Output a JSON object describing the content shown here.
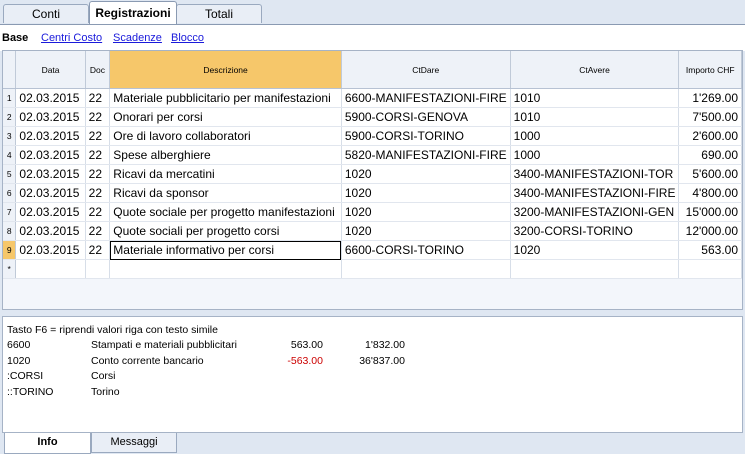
{
  "top_tabs": [
    "Conti",
    "Registrazioni",
    "Totali"
  ],
  "active_top_tab": "Registrazioni",
  "sub_views": {
    "active": "Base",
    "links": [
      "Centri Costo",
      "Scadenze",
      "Blocco"
    ]
  },
  "grid": {
    "columns": [
      "Data",
      "Doc",
      "Descrizione",
      "CtDare",
      "CtAvere",
      "Importo CHF"
    ],
    "rows": [
      {
        "n": "1",
        "data": "02.03.2015",
        "doc": "22",
        "desc": "Materiale pubblicitario per manifestazioni",
        "dare": "6600-MANIFESTAZIONI-FIRE",
        "avere": "1010",
        "importo": "1'269.00"
      },
      {
        "n": "2",
        "data": "02.03.2015",
        "doc": "22",
        "desc": "Onorari per corsi",
        "dare": "5900-CORSI-GENOVA",
        "avere": "1010",
        "importo": "7'500.00"
      },
      {
        "n": "3",
        "data": "02.03.2015",
        "doc": "22",
        "desc": "Ore di lavoro collaboratori",
        "dare": "5900-CORSI-TORINO",
        "avere": "1000",
        "importo": "2'600.00"
      },
      {
        "n": "4",
        "data": "02.03.2015",
        "doc": "22",
        "desc": "Spese alberghiere",
        "dare": "5820-MANIFESTAZIONI-FIRE",
        "avere": "1000",
        "importo": "690.00"
      },
      {
        "n": "5",
        "data": "02.03.2015",
        "doc": "22",
        "desc": "Ricavi da mercatini",
        "dare": "1020",
        "avere": "3400-MANIFESTAZIONI-TOR",
        "importo": "5'600.00"
      },
      {
        "n": "6",
        "data": "02.03.2015",
        "doc": "22",
        "desc": "Ricavi da sponsor",
        "dare": "1020",
        "avere": "3400-MANIFESTAZIONI-FIRE",
        "importo": "4'800.00"
      },
      {
        "n": "7",
        "data": "02.03.2015",
        "doc": "22",
        "desc": "Quote sociale per progetto manifestazioni",
        "dare": "1020",
        "avere": "3200-MANIFESTAZIONI-GEN",
        "importo": "15'000.00"
      },
      {
        "n": "8",
        "data": "02.03.2015",
        "doc": "22",
        "desc": "Quote sociali per progetto corsi",
        "dare": "1020",
        "avere": "3200-CORSI-TORINO",
        "importo": "12'000.00"
      },
      {
        "n": "9",
        "data": "02.03.2015",
        "doc": "22",
        "desc": "Materiale informativo per corsi",
        "dare": "6600-CORSI-TORINO",
        "avere": "1020",
        "importo": "563.00"
      }
    ],
    "new_row_marker": "*"
  },
  "info": {
    "hint": "Tasto F6 = riprendi valori riga con testo simile",
    "lines": [
      {
        "code": "6600",
        "desc": "Stampati e materiali pubblicitari",
        "amount": "563.00",
        "balance": "1'832.00",
        "negative": false
      },
      {
        "code": "1020",
        "desc": "Conto corrente bancario",
        "amount": "-563.00",
        "balance": "36'837.00",
        "negative": true
      },
      {
        "code": ":CORSI",
        "desc": "Corsi",
        "amount": "",
        "balance": "",
        "negative": false
      },
      {
        "code": "::TORINO",
        "desc": "Torino",
        "amount": "",
        "balance": "",
        "negative": false
      }
    ]
  },
  "bottom_tabs": [
    "Info",
    "Messaggi"
  ],
  "active_bottom_tab": "Info"
}
